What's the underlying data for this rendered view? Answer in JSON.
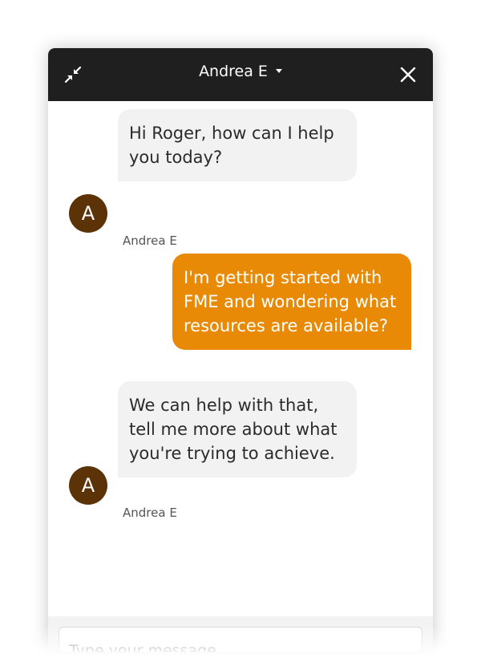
{
  "header": {
    "agent_name": "Andrea E",
    "minimize_icon": "minimize-arrows-icon",
    "dropdown_icon": "caret-down-icon",
    "close_icon": "close-icon",
    "background": "#1f1f1f"
  },
  "messages": [
    {
      "from": "agent",
      "avatar_initial": "A",
      "text": "Hi Roger, how can I help you today?",
      "sender": "Andrea E"
    },
    {
      "from": "user",
      "text": "I'm getting started with FME and wondering what resources are available?"
    },
    {
      "from": "agent",
      "avatar_initial": "A",
      "text": "We can help with that, tell me more about what you're trying to achieve.",
      "sender": "Andrea E"
    }
  ],
  "input": {
    "placeholder": "Type your message..."
  },
  "colors": {
    "user_bubble": "#e88a05",
    "agent_bubble": "#f2f2f2",
    "avatar": "#5c3306"
  }
}
